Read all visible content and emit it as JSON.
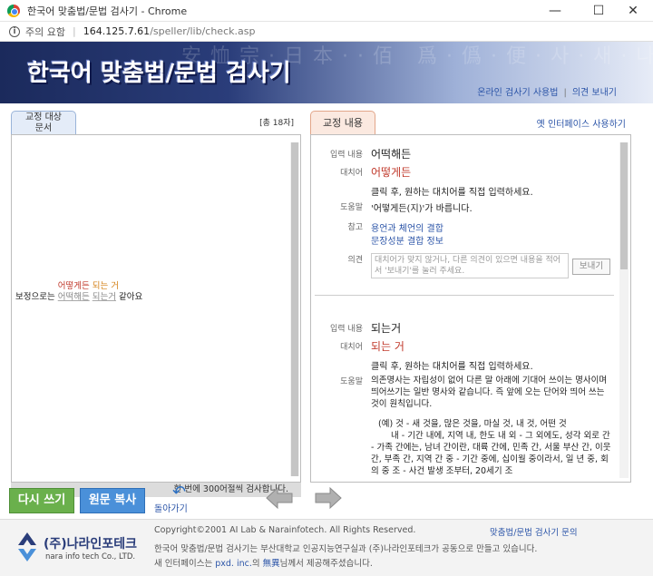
{
  "window": {
    "title": "한국어 맞춤법/문법 검사기 - Chrome",
    "minimize": "—",
    "maximize": "☐",
    "close": "✕"
  },
  "address": {
    "security_label": "주의 요함",
    "host": "164.125.7.61",
    "path": "/speller/lib/check.asp"
  },
  "banner": {
    "title": "한국어 맞춤법/문법 검사기",
    "bg_text": "安恤宗·日本··佰 爲·僞·便·사·새·나·이·文 나",
    "link_usage": "온라인 검사기 사용법",
    "link_feedback": "의견 보내기"
  },
  "left": {
    "tab_label_1": "교정 대상",
    "tab_label_2": "문서",
    "char_count": "[총 18자]",
    "text_prefix": "보정으로는",
    "error_word_1": "어떡해든",
    "error_word_2": "되는거",
    "text_suffix": "같아요",
    "suggestion_1": "어떻게든",
    "suggestion_2": "되는 거",
    "footer_note": "한 번에 300어절씩 검사합니다."
  },
  "right": {
    "tab_label": "교정 내용",
    "old_ui_link": "옛 인터페이스 사용하기",
    "labels": {
      "input": "입력 내용",
      "replace": "대치어",
      "help": "도움말",
      "ref": "참고",
      "opinion": "의견"
    },
    "entry1": {
      "input": "어떡해든",
      "replace": "어떻게든",
      "instruction": "클릭 후, 원하는 대치어를 직접 입력하세요.",
      "help": "'어떻게든(지)'가 바릅니다.",
      "ref_1": "용언과 체언의 결합",
      "ref_2": "문장성분 결합 정보",
      "opinion_placeholder": "대치어가 맞지 않거나, 다른 의견이 있으면 내용을 적어서 '보내기'를 눌러 주세요.",
      "send_label": "보내기"
    },
    "entry2": {
      "input": "되는거",
      "replace": "되는 거",
      "instruction": "클릭 후, 원하는 대치어를 직접 입력하세요.",
      "help": "의존명사는 자립성이 없어 다른 말 아래에 기대어 쓰이는 명사이며 띄어쓰기는 일반 명사와 같습니다. 즉 앞에 오는 단어와 띄어 쓰는 것이 원칙입니다.",
      "example_1": "(예) 것 - 새 것을, 많은 것을, 마실 것, 내 것, 어떤 것",
      "example_2": "내 - 기간 내에, 지역 내, 한도 내 외 - 그 외에도, 성각 외로 간 - 가족 간에는, 남녀 간이란, 대륙 간에, 민족 간, 서울 부산 간, 이웃 간, 부족 간, 지역 간 중 - 기간 중에, 십이월 중이라서, 일 년 중, 회의 중 조 - 사건 발생 조부터, 20세기 조"
    }
  },
  "buttons": {
    "retype": "다시 쓰기",
    "copy": "원문 복사",
    "back": "돌아가기"
  },
  "footer": {
    "logo_ko": "(주)나라인포테크",
    "logo_en": "nara info tech Co., LTD.",
    "copyright": "Copyright©2001 AI Lab & Narainfotech. All Rights Reserved.",
    "contact": "맞춤법/문법 검사기 문의",
    "made_by": "한국어 맞춤법/문법 검사기는 부산대학교 인공지능연구실과 (주)나라인포테크가 공동으로 만들고 있습니다.",
    "interface_prefix": "새 인터페이스는",
    "interface_link_1": "pxd. inc.",
    "interface_mid": "의",
    "interface_link_2": "無異",
    "interface_suffix": "님께서 제공해주셨습니다."
  },
  "colors": {
    "error_red": "#c0392b",
    "error_orange": "#d48117",
    "link_blue": "#2c55a8",
    "retype_green": "#6ab04c",
    "copy_blue": "#4a90d9"
  }
}
